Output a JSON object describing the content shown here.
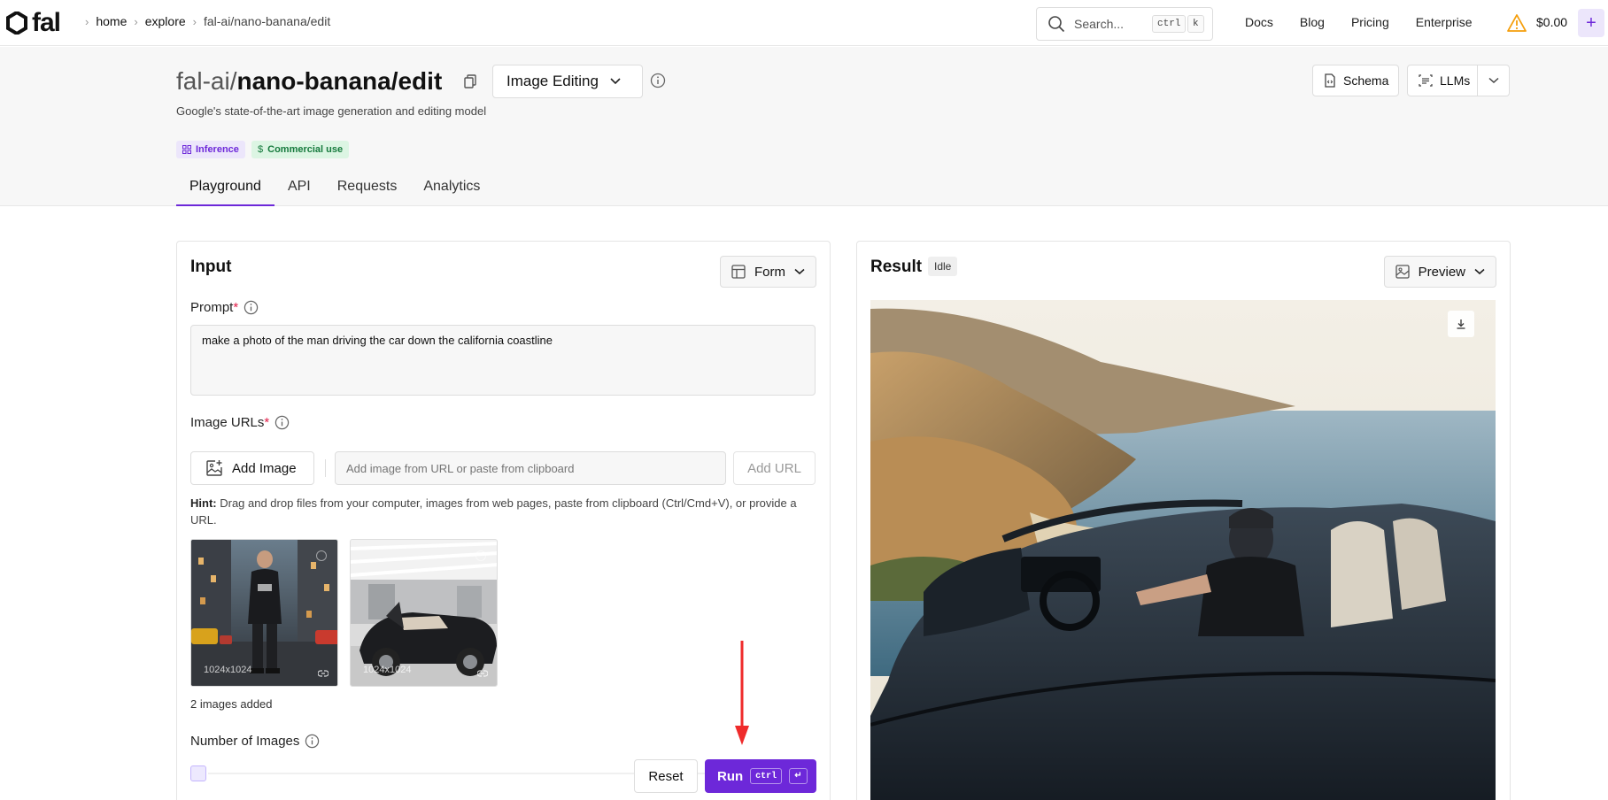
{
  "nav": {
    "logo": "fal",
    "breadcrumbs": [
      "home",
      "explore",
      "fal-ai/nano-banana/edit"
    ],
    "search": {
      "placeholder": "Search...",
      "key1": "ctrl",
      "key2": "k"
    },
    "links": [
      "Docs",
      "Blog",
      "Pricing",
      "Enterprise"
    ],
    "balance": "$0.00",
    "add_label": "+"
  },
  "header": {
    "title_prefix": "fal-ai/",
    "title_main": "nano-banana/edit",
    "category": "Image Editing",
    "subtitle": "Google's state-of-the-art image generation and editing model",
    "badges": [
      "Inference",
      "Commercial use"
    ],
    "schema_label": "Schema",
    "llms_label": "LLMs",
    "tabs": [
      "Playground",
      "API",
      "Requests",
      "Analytics"
    ],
    "active_tab": "Playground"
  },
  "input": {
    "title": "Input",
    "view_mode": "Form",
    "prompt_label": "Prompt",
    "required_mark": "*",
    "prompt_value": "make a photo of the man driving the car down the california coastline",
    "image_urls_label": "Image URLs",
    "add_image_label": "Add Image",
    "url_placeholder": "Add image from URL or paste from clipboard",
    "add_url_label": "Add URL",
    "hint_bold": "Hint:",
    "hint_text": " Drag and drop files from your computer, images from web pages, paste from clipboard (Ctrl/Cmd+V), or provide a URL.",
    "images": [
      {
        "dims": "1024x1024"
      },
      {
        "dims": "1024x1024"
      }
    ],
    "images_count": "2 images added",
    "num_images_label": "Number of Images",
    "reset_label": "Reset",
    "run_label": "Run",
    "run_key1": "ctrl",
    "run_key2": "↵"
  },
  "result": {
    "title": "Result",
    "status": "Idle",
    "view_mode": "Preview"
  },
  "colors": {
    "accent": "#6d28d9",
    "annotation_arrow": "#ef2b2b"
  }
}
